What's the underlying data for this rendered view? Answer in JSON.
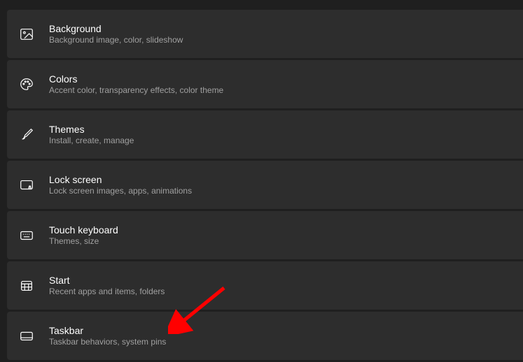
{
  "items": [
    {
      "title": "Background",
      "subtitle": "Background image, color, slideshow"
    },
    {
      "title": "Colors",
      "subtitle": "Accent color, transparency effects, color theme"
    },
    {
      "title": "Themes",
      "subtitle": "Install, create, manage"
    },
    {
      "title": "Lock screen",
      "subtitle": "Lock screen images, apps, animations"
    },
    {
      "title": "Touch keyboard",
      "subtitle": "Themes, size"
    },
    {
      "title": "Start",
      "subtitle": "Recent apps and items, folders"
    },
    {
      "title": "Taskbar",
      "subtitle": "Taskbar behaviors, system pins"
    }
  ]
}
